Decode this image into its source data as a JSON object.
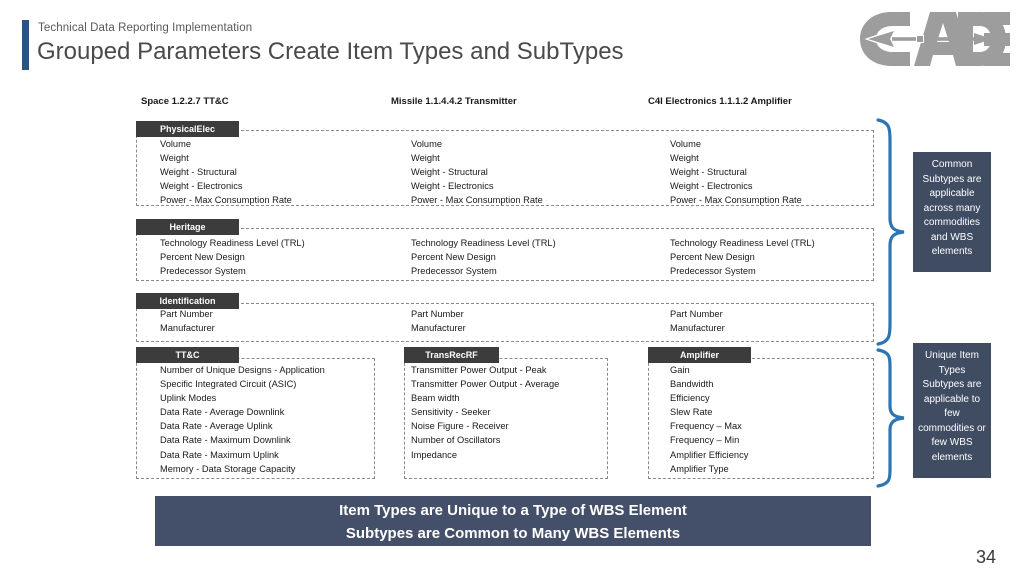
{
  "header": {
    "eyebrow": "Technical Data Reporting Implementation",
    "title": "Grouped Parameters Create Item Types and SubTypes",
    "accent_color": "#2A5580",
    "logo_text": "CADE",
    "logo_icon": "cade-dart-logo"
  },
  "columns": [
    {
      "label": "Space 1.2.2.7 TT&C"
    },
    {
      "label": "Missile 1.1.4.4.2 Transmitter"
    },
    {
      "label": "C4I Electronics 1.1.1.2 Amplifier"
    }
  ],
  "groups": [
    {
      "id": "physicalelec",
      "label": "PhysicalElec",
      "columns": [
        [
          "Volume",
          "Weight",
          "Weight - Structural",
          "Weight - Electronics",
          "Power - Max Consumption Rate"
        ],
        [
          "Volume",
          "Weight",
          "Weight - Structural",
          "Weight - Electronics",
          "Power - Max Consumption Rate"
        ],
        [
          "Volume",
          "Weight",
          "Weight - Structural",
          "Weight - Electronics",
          "Power - Max Consumption Rate"
        ]
      ]
    },
    {
      "id": "heritage",
      "label": "Heritage",
      "columns": [
        [
          "Technology Readiness Level (TRL)",
          "Percent New Design",
          "Predecessor System"
        ],
        [
          "Technology Readiness Level (TRL)",
          "Percent New Design",
          "Predecessor System"
        ],
        [
          "Technology Readiness Level (TRL)",
          "Percent New Design",
          "Predecessor System"
        ]
      ]
    },
    {
      "id": "identification",
      "label": "Identification",
      "columns": [
        [
          "Part Number",
          "Manufacturer"
        ],
        [
          "Part Number",
          "Manufacturer"
        ],
        [
          "Part Number",
          "Manufacturer"
        ]
      ]
    }
  ],
  "unique_groups": [
    {
      "id": "ttc",
      "label": "TT&C",
      "items": [
        "Number of Unique Designs - Application",
        "Specific Integrated Circuit (ASIC)",
        "Uplink Modes",
        "Data Rate - Average Downlink",
        "Data Rate - Average Uplink",
        "Data Rate - Maximum Downlink",
        "Data Rate - Maximum Uplink",
        "Memory - Data Storage Capacity"
      ]
    },
    {
      "id": "transrecrf",
      "label": "TransRecRF",
      "items": [
        "Transmitter Power Output - Peak",
        "Transmitter Power Output - Average",
        "Beam width",
        "Sensitivity - Seeker",
        "Noise Figure - Receiver",
        "Number of Oscillators",
        "Impedance"
      ]
    },
    {
      "id": "amplifier",
      "label": "Amplifier",
      "items": [
        "Gain",
        "Bandwidth",
        "Efficiency",
        "Slew Rate",
        "Frequency – Max",
        "Frequency – Min",
        "Amplifier Efficiency",
        "Amplifier Type"
      ]
    }
  ],
  "callouts": {
    "top": "Common Subtypes are applicable across many commodities and WBS elements",
    "bottom": "Unique Item Types Subtypes are applicable to few commodities or few WBS elements",
    "background_color": "#3F4C62"
  },
  "banner": {
    "line1": "Item Types are Unique to a Type of WBS Element",
    "line2": "Subtypes are Common to Many WBS Elements",
    "background_color": "#44506A"
  },
  "page_number": "34",
  "brace_color": "#2E75B6"
}
